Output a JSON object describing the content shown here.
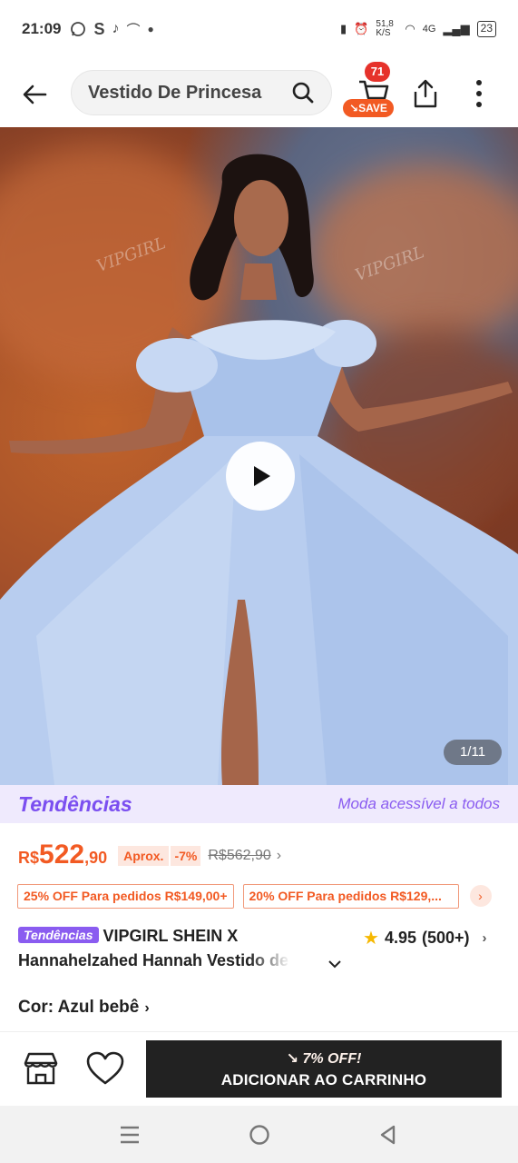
{
  "status_bar": {
    "time": "21:09",
    "left_icons": [
      "whatsapp-icon",
      "s-icon",
      "tiktok-icon",
      "app-icon",
      "dot-icon"
    ],
    "net_speed": "51,8 K/S",
    "network": "4G",
    "battery": "23"
  },
  "header": {
    "search_query": "Vestido De Princesa",
    "cart_count": "71",
    "save_label": "SAVE"
  },
  "gallery": {
    "counter": "1/11",
    "watermark": "VIPGIRL"
  },
  "trends": {
    "logo": "Tendências",
    "slogan": "Moda acessível a todos"
  },
  "price": {
    "currency": "R$",
    "integer": "522",
    "cents": ",90",
    "aprox_label": "Aprox.",
    "discount": "-7%",
    "original": "R$562,90"
  },
  "coupons": [
    {
      "label": "25% OFF Para pedidos R$149,00+"
    },
    {
      "label": "20% OFF Para pedidos R$129,..."
    }
  ],
  "product": {
    "badge": "Tendências",
    "title_line1": "VIPGIRL SHEIN X",
    "title_line2": "Hannahelzahed Hannah Vestido de",
    "rating": "4.95",
    "reviews": "(500+)",
    "color_label": "Cor: Azul bebê"
  },
  "action_bar": {
    "promo": "7% OFF!",
    "add_to_cart": "ADICIONAR AO CARRINHO"
  },
  "colors": {
    "accent_orange": "#f25a23",
    "trends_purple": "#8a5cf0",
    "dress_blue": "#b7cdf0",
    "button_dark": "#222222"
  }
}
